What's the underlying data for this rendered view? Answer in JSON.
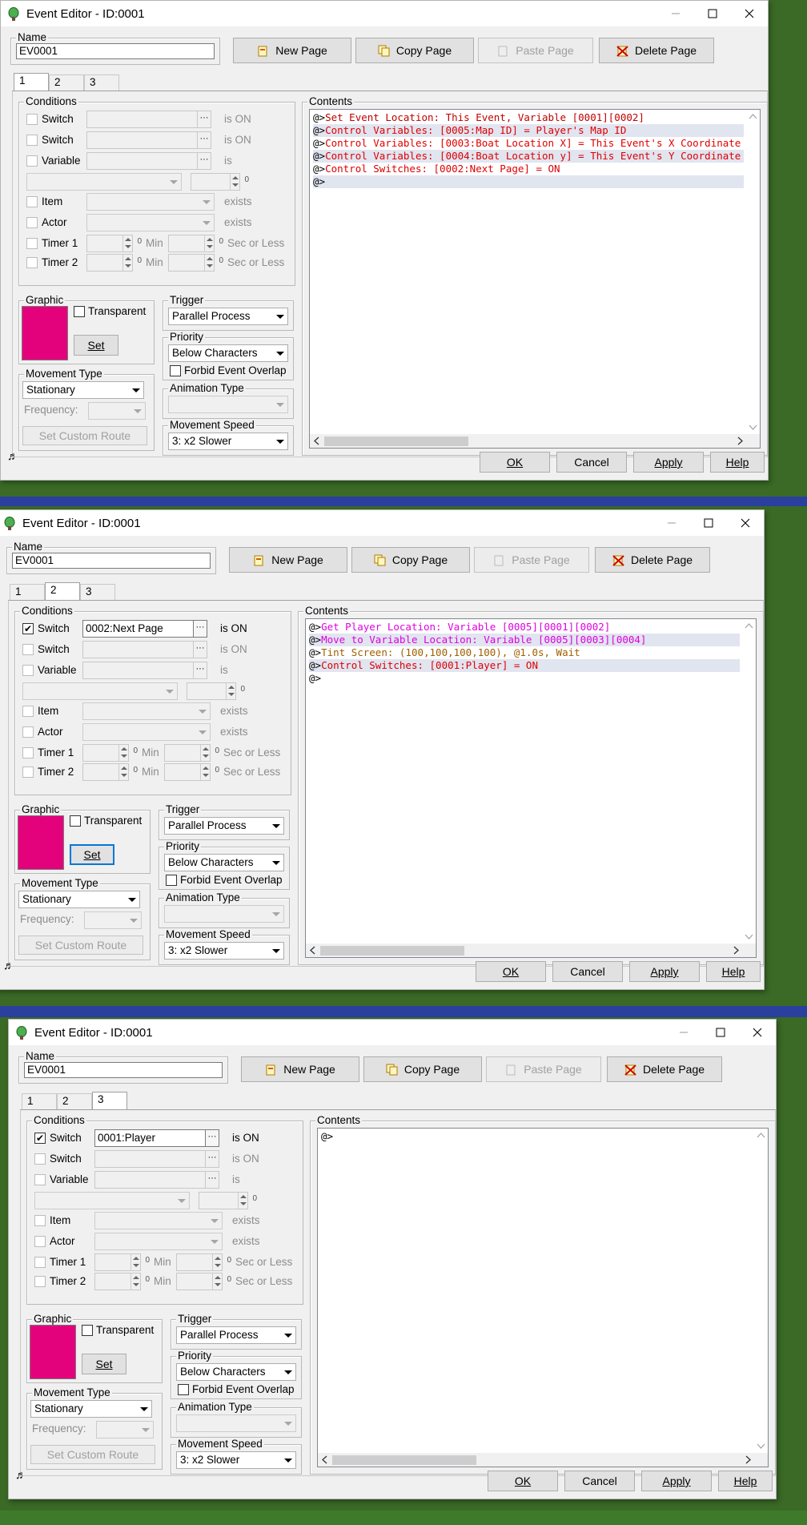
{
  "windows": [
    {
      "title": "Event Editor - ID:0001",
      "name_label": "Name",
      "name_value": "EV0001",
      "buttons": {
        "new_page": "New Page",
        "copy_page": "Copy Page",
        "paste_page": "Paste Page",
        "delete_page": "Delete Page"
      },
      "tabs": [
        "1",
        "2",
        "3"
      ],
      "selected_tab": 0,
      "conditions": {
        "legend": "Conditions",
        "switch1": {
          "label": "Switch",
          "checked": false,
          "value": "",
          "suffix": "is ON"
        },
        "switch2": {
          "label": "Switch",
          "checked": false,
          "value": "",
          "suffix": "is ON"
        },
        "variable": {
          "label": "Variable",
          "checked": false,
          "value": "",
          "suffix": "is"
        },
        "variable_value": "0",
        "item": {
          "label": "Item",
          "suffix": "exists"
        },
        "actor": {
          "label": "Actor",
          "suffix": "exists"
        },
        "timer1": {
          "label": "Timer 1",
          "min": "Min",
          "suffix": "Sec or Less",
          "zero_a": "0",
          "zero_b": "0"
        },
        "timer2": {
          "label": "Timer 2",
          "min": "Min",
          "suffix": "Sec or Less",
          "zero_a": "0",
          "zero_b": "0"
        }
      },
      "graphic": {
        "legend": "Graphic",
        "transparent": "Transparent",
        "set": "Set",
        "color": "#e4027c"
      },
      "trigger": {
        "legend": "Trigger",
        "value": "Parallel Process"
      },
      "priority": {
        "legend": "Priority",
        "value": "Below Characters",
        "forbid": "Forbid Event Overlap"
      },
      "movement_type": {
        "legend": "Movement Type",
        "value": "Stationary",
        "frequency": "Frequency:",
        "custom_route": "Set Custom Route"
      },
      "animation_type": {
        "legend": "Animation Type",
        "value": ""
      },
      "movement_speed": {
        "legend": "Movement Speed",
        "value": "3: x2 Slower"
      },
      "contents": {
        "legend": "Contents",
        "lines": [
          {
            "prefix": "@>",
            "text": "Set Event Location: This Event, Variable [0001][0002]",
            "color": "#c00000"
          },
          {
            "prefix": "@>",
            "text": "Control Variables: [0005:Map ID] = Player's Map ID",
            "color": "#e00000"
          },
          {
            "prefix": "@>",
            "text": "Control Variables: [0003:Boat Location X] = This Event's X Coordinate",
            "color": "#e00000"
          },
          {
            "prefix": "@>",
            "text": "Control Variables: [0004:Boat Location y] = This Event's Y Coordinate",
            "color": "#e00000"
          },
          {
            "prefix": "@>",
            "text": "Control Switches: [0002:Next Page] = ON",
            "color": "#e00000"
          },
          {
            "prefix": "@>",
            "text": "",
            "color": "#000000"
          }
        ]
      },
      "footer": {
        "ok": "OK",
        "cancel": "Cancel",
        "apply": "Apply",
        "help": "Help"
      }
    },
    {
      "title": "Event Editor - ID:0001",
      "name_label": "Name",
      "name_value": "EV0001",
      "buttons": {
        "new_page": "New Page",
        "copy_page": "Copy Page",
        "paste_page": "Paste Page",
        "delete_page": "Delete Page"
      },
      "tabs": [
        "1",
        "2",
        "3"
      ],
      "selected_tab": 1,
      "conditions": {
        "legend": "Conditions",
        "switch1": {
          "label": "Switch",
          "checked": true,
          "value": "0002:Next Page",
          "suffix": "is ON"
        },
        "switch2": {
          "label": "Switch",
          "checked": false,
          "value": "",
          "suffix": "is ON"
        },
        "variable": {
          "label": "Variable",
          "checked": false,
          "value": "",
          "suffix": "is"
        },
        "variable_value": "0",
        "item": {
          "label": "Item",
          "suffix": "exists"
        },
        "actor": {
          "label": "Actor",
          "suffix": "exists"
        },
        "timer1": {
          "label": "Timer 1",
          "min": "Min",
          "suffix": "Sec or Less",
          "zero_a": "0",
          "zero_b": "0"
        },
        "timer2": {
          "label": "Timer 2",
          "min": "Min",
          "suffix": "Sec or Less",
          "zero_a": "0",
          "zero_b": "0"
        }
      },
      "graphic": {
        "legend": "Graphic",
        "transparent": "Transparent",
        "set": "Set",
        "color": "#e4027c"
      },
      "trigger": {
        "legend": "Trigger",
        "value": "Parallel Process"
      },
      "priority": {
        "legend": "Priority",
        "value": "Below Characters",
        "forbid": "Forbid Event Overlap"
      },
      "movement_type": {
        "legend": "Movement Type",
        "value": "Stationary",
        "frequency": "Frequency:",
        "custom_route": "Set Custom Route"
      },
      "animation_type": {
        "legend": "Animation Type",
        "value": ""
      },
      "movement_speed": {
        "legend": "Movement Speed",
        "value": "3: x2 Slower"
      },
      "contents": {
        "legend": "Contents",
        "lines": [
          {
            "prefix": "@>",
            "text": "Get Player Location: Variable [0005][0001][0002]",
            "color": "#e000e0"
          },
          {
            "prefix": "@>",
            "text": "Move to Variable Location: Variable [0005][0003][0004]",
            "color": "#e000e0"
          },
          {
            "prefix": "@>",
            "text": "Tint Screen: (100,100,100,100), @1.0s, Wait",
            "color": "#a06000"
          },
          {
            "prefix": "@>",
            "text": "Control Switches: [0001:Player] = ON",
            "color": "#e00000"
          },
          {
            "prefix": "@>",
            "text": "",
            "color": "#000000"
          }
        ]
      },
      "footer": {
        "ok": "OK",
        "cancel": "Cancel",
        "apply": "Apply",
        "help": "Help"
      }
    },
    {
      "title": "Event Editor - ID:0001",
      "name_label": "Name",
      "name_value": "EV0001",
      "buttons": {
        "new_page": "New Page",
        "copy_page": "Copy Page",
        "paste_page": "Paste Page",
        "delete_page": "Delete Page"
      },
      "tabs": [
        "1",
        "2",
        "3"
      ],
      "selected_tab": 2,
      "conditions": {
        "legend": "Conditions",
        "switch1": {
          "label": "Switch",
          "checked": true,
          "value": "0001:Player",
          "suffix": "is ON"
        },
        "switch2": {
          "label": "Switch",
          "checked": false,
          "value": "",
          "suffix": "is ON"
        },
        "variable": {
          "label": "Variable",
          "checked": false,
          "value": "",
          "suffix": "is"
        },
        "variable_value": "0",
        "item": {
          "label": "Item",
          "suffix": "exists"
        },
        "actor": {
          "label": "Actor",
          "suffix": "exists"
        },
        "timer1": {
          "label": "Timer 1",
          "min": "Min",
          "suffix": "Sec or Less",
          "zero_a": "0",
          "zero_b": "0"
        },
        "timer2": {
          "label": "Timer 2",
          "min": "Min",
          "suffix": "Sec or Less",
          "zero_a": "0",
          "zero_b": "0"
        }
      },
      "graphic": {
        "legend": "Graphic",
        "transparent": "Transparent",
        "set": "Set",
        "color": "#e4027c"
      },
      "trigger": {
        "legend": "Trigger",
        "value": "Parallel Process"
      },
      "priority": {
        "legend": "Priority",
        "value": "Below Characters",
        "forbid": "Forbid Event Overlap"
      },
      "movement_type": {
        "legend": "Movement Type",
        "value": "Stationary",
        "frequency": "Frequency:",
        "custom_route": "Set Custom Route"
      },
      "animation_type": {
        "legend": "Animation Type",
        "value": ""
      },
      "movement_speed": {
        "legend": "Movement Speed",
        "value": "3: x2 Slower"
      },
      "contents": {
        "legend": "Contents",
        "lines": [
          {
            "prefix": "@>",
            "text": "",
            "color": "#000000"
          }
        ]
      },
      "footer": {
        "ok": "OK",
        "cancel": "Cancel",
        "apply": "Apply",
        "help": "Help"
      }
    }
  ]
}
